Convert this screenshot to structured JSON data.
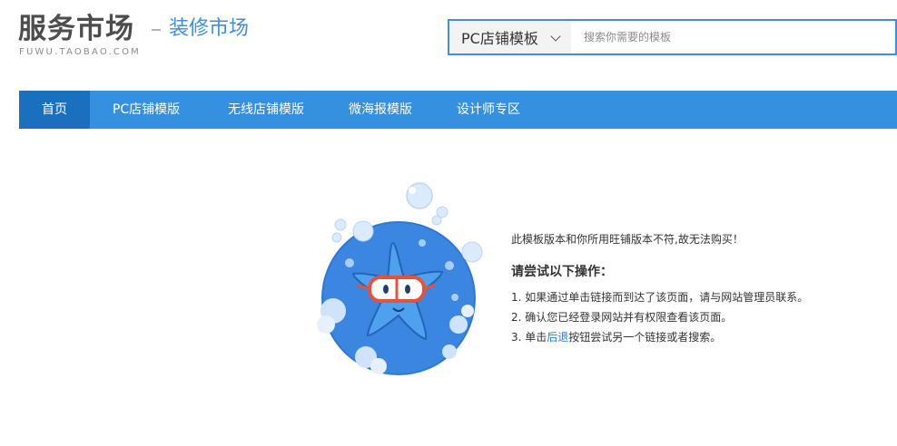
{
  "header": {
    "logo_main": "服务市场",
    "logo_sub": "FUWU.TAOBAO.COM",
    "section_title": "装修市场"
  },
  "search": {
    "category": "PC店铺模板",
    "placeholder": "搜索你需要的模板",
    "value": ""
  },
  "nav": {
    "items": [
      {
        "label": "首页",
        "active": true
      },
      {
        "label": "PC店铺模版",
        "active": false
      },
      {
        "label": "无线店铺模版",
        "active": false
      },
      {
        "label": "微海报模版",
        "active": false
      },
      {
        "label": "设计师专区",
        "active": false
      }
    ]
  },
  "message": {
    "error_text": "此模板版本和你所用旺铺版本不符,故无法购买！",
    "title": "请尝试以下操作：",
    "step1": "1. 如果通过单击链接而到达了该页面，请与网站管理员联系。",
    "step2": "2. 确认您已经登录网站并有权限查看该页面。",
    "step3_prefix": "3. 单击",
    "step3_link": "后退",
    "step3_suffix": "按钮尝试另一个链接或者搜索。"
  },
  "colors": {
    "brand_blue": "#3690e0",
    "nav_active": "#1a6fbf",
    "link": "#2a7fd4",
    "mascot_red": "#e8503a"
  },
  "icons": [
    "chevron-down-icon",
    "starfish-mascot-illustration"
  ]
}
